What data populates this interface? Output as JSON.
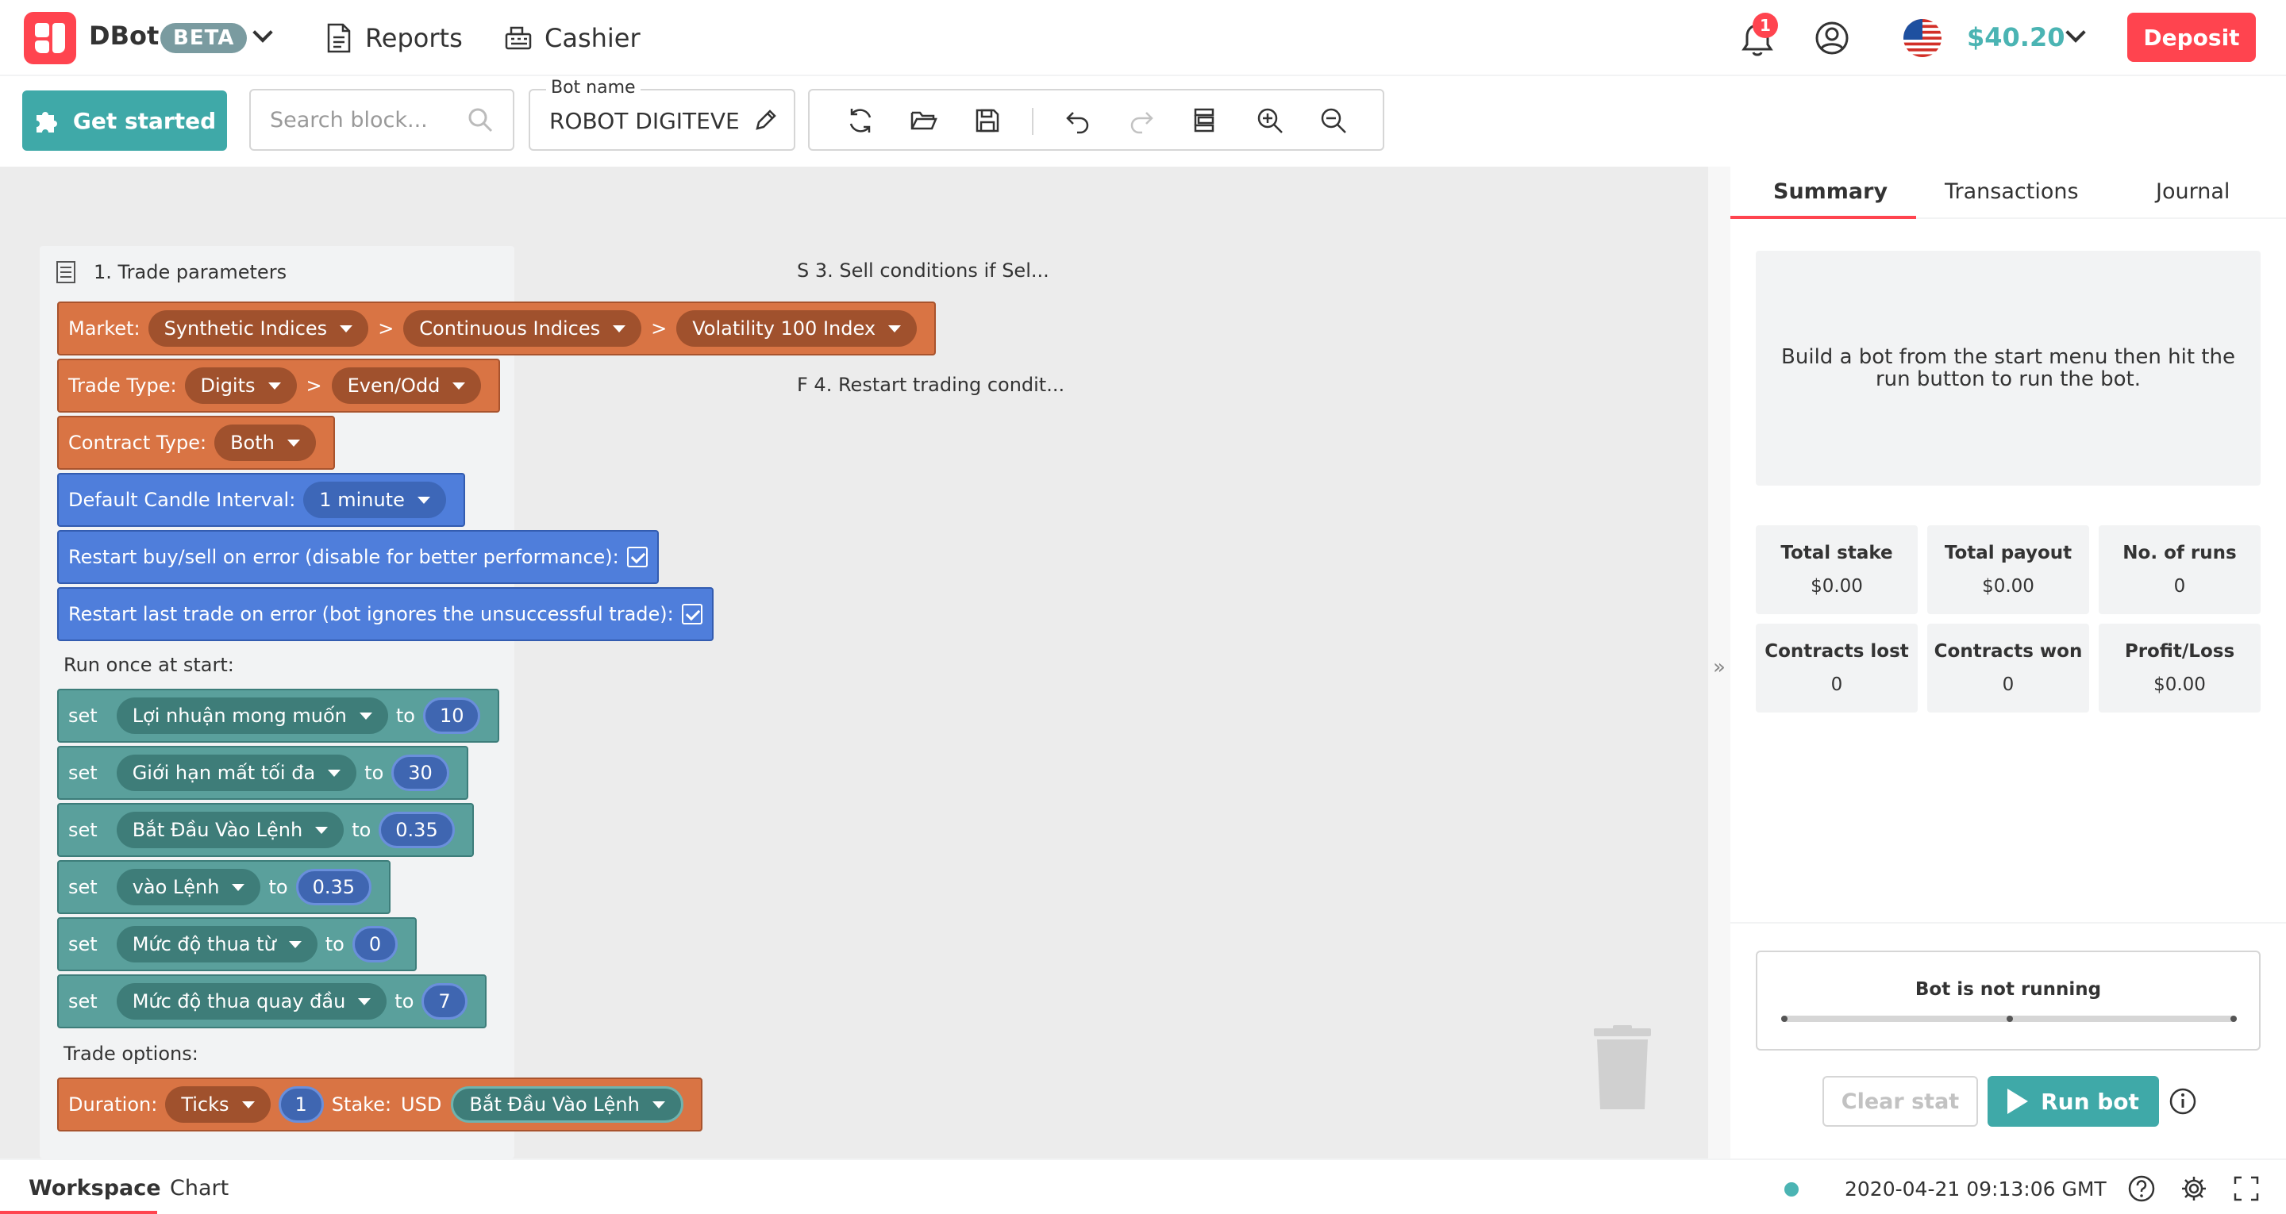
{
  "header": {
    "app_name": "DBot",
    "beta": "BETA",
    "nav": [
      {
        "label": "Reports",
        "icon": "report-icon"
      },
      {
        "label": "Cashier",
        "icon": "cashier-icon"
      }
    ],
    "notifications_count": "1",
    "balance": "$40.20",
    "deposit_label": "Deposit"
  },
  "toolbar": {
    "get_started": "Get started",
    "search_placeholder": "Search block...",
    "bot_name_label": "Bot name",
    "bot_name_value": "ROBOT DIGITEVEN"
  },
  "workspace": {
    "group_title": "1. Trade parameters",
    "market_label": "Market:",
    "market": [
      "Synthetic Indices",
      "Continuous Indices",
      "Volatility 100 Index"
    ],
    "trade_type_label": "Trade Type:",
    "trade_type": [
      "Digits",
      "Even/Odd"
    ],
    "contract_type_label": "Contract Type:",
    "contract_type": "Both",
    "candle_label": "Default Candle Interval:",
    "candle_value": "1 minute",
    "restart_buysell": "Restart buy/sell on error (disable for better performance):",
    "restart_last": "Restart last trade on error (bot ignores the unsuccessful trade):",
    "run_once": "Run once at start:",
    "set_word": "set",
    "to_word": "to",
    "variables": [
      {
        "name": "Lợi nhuận mong muốn",
        "value": "10"
      },
      {
        "name": "Giới hạn mất tối đa",
        "value": "30"
      },
      {
        "name": "Bắt Đầu Vào Lệnh",
        "value": "0.35"
      },
      {
        "name": "vào Lệnh",
        "value": "0.35"
      },
      {
        "name": "Mức độ thua từ",
        "value": "0"
      },
      {
        "name": "Mức độ thua quay đầu",
        "value": "7"
      }
    ],
    "trade_options": "Trade options:",
    "duration_label": "Duration:",
    "duration_unit": "Ticks",
    "duration_value": "1",
    "stake_label": "Stake:",
    "currency": "USD",
    "stake_var": "Bắt Đầu Vào Lệnh",
    "collapsed_sell": "S 3. Sell conditions if Sel...",
    "collapsed_restart": "F 4. Restart trading condit..."
  },
  "panel": {
    "tabs": [
      "Summary",
      "Transactions",
      "Journal"
    ],
    "info": "Build a bot from the start menu then hit the run button to run the bot.",
    "stats": [
      {
        "title": "Total stake",
        "value": "$0.00"
      },
      {
        "title": "Total payout",
        "value": "$0.00"
      },
      {
        "title": "No. of runs",
        "value": "0"
      },
      {
        "title": "Contracts lost",
        "value": "0"
      },
      {
        "title": "Contracts won",
        "value": "0"
      },
      {
        "title": "Profit/Loss",
        "value": "$0.00"
      }
    ],
    "status": "Bot is not running",
    "clear_stat": "Clear stat",
    "run_bot": "Run bot"
  },
  "footer": {
    "tabs": [
      "Workspace",
      "Chart"
    ],
    "time": "2020-04-21 09:13:06 GMT"
  },
  "colors": {
    "brand_red": "#ff444f",
    "teal": "#3fa9a8",
    "balance_green": "#4bb4b3",
    "orange_block": "#d97444",
    "blue_block": "#4f7edb",
    "teal_block": "#5aa09c"
  }
}
